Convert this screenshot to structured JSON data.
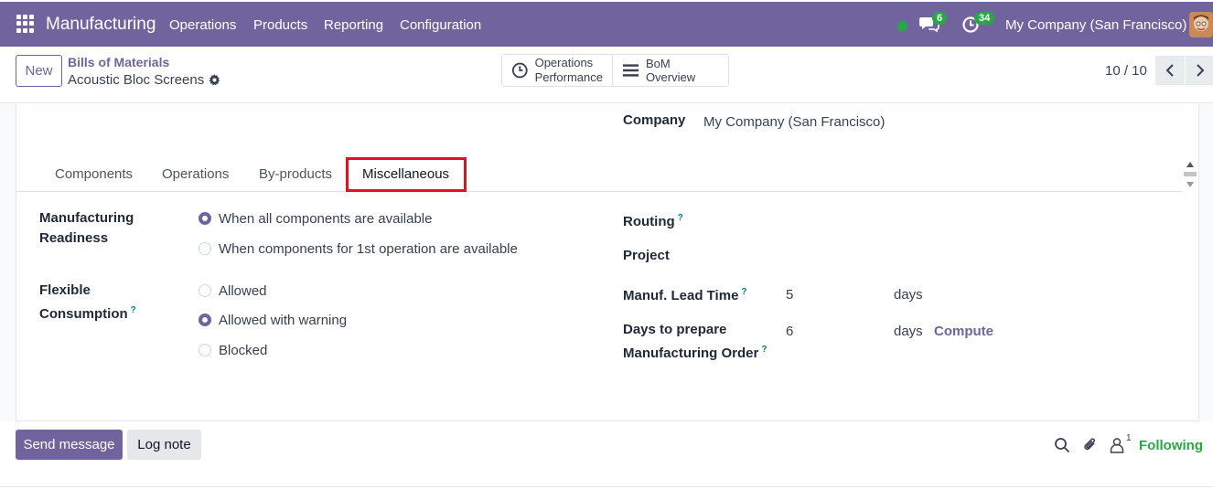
{
  "navbar": {
    "app_name": "Manufacturing",
    "menu": [
      "Operations",
      "Products",
      "Reporting",
      "Configuration"
    ],
    "messages_count": "6",
    "activities_count": "34",
    "company": "My Company (San Francisco)",
    "color": "#71639e"
  },
  "control": {
    "new_label": "New",
    "breadcrumb_parent": "Bills of Materials",
    "breadcrumb_current": "Acoustic Bloc Screens",
    "smart_buttons": {
      "ops_perf_line1": "Operations",
      "ops_perf_line2": "Performance",
      "bom_overview": "BoM Overview"
    },
    "pager": "10 / 10"
  },
  "form": {
    "company_label": "Company",
    "company_value": "My Company (San Francisco)",
    "tabs": [
      "Components",
      "Operations",
      "By-products",
      "Miscellaneous"
    ],
    "active_tab": "Miscellaneous",
    "readiness_label_1": "Manufacturing",
    "readiness_label_2": "Readiness",
    "readiness_options": [
      "When all components are available",
      "When components for 1st operation are available"
    ],
    "flexible_label_1": "Flexible",
    "flexible_label_2": "Consumption",
    "flexible_options": [
      "Allowed",
      "Allowed with warning",
      "Blocked"
    ],
    "routing_label": "Routing",
    "project_label": "Project",
    "lead_time_label": "Manuf. Lead Time",
    "lead_time_value": "5",
    "lead_time_unit": "days",
    "prepare_label_1": "Days to prepare",
    "prepare_label_2": "Manufacturing Order",
    "prepare_value": "6",
    "prepare_unit": "days",
    "compute_label": "Compute",
    "help_mark": "?"
  },
  "chatter": {
    "send_message": "Send message",
    "log_note": "Log note",
    "followers_count": "1",
    "following": "Following"
  }
}
